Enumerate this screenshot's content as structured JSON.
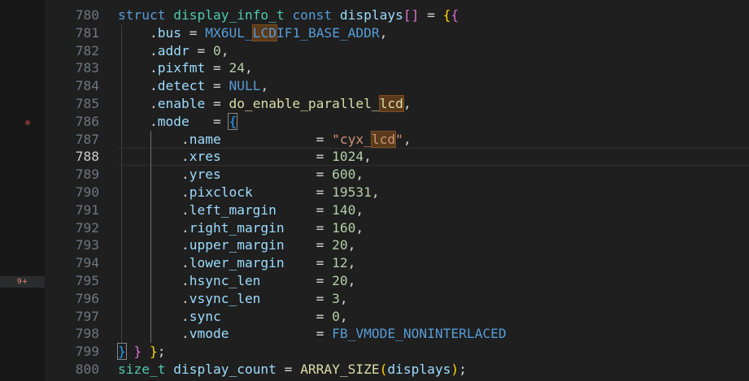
{
  "gutter": {
    "badge_text": "9+"
  },
  "editor": {
    "active_line": 788,
    "lines": [
      {
        "num": "780",
        "tokens": [
          [
            "kw",
            "struct"
          ],
          [
            "op",
            " "
          ],
          [
            "ty",
            "display_info_t"
          ],
          [
            "op",
            " "
          ],
          [
            "kw",
            "const"
          ],
          [
            "op",
            " "
          ],
          [
            "id",
            "displays"
          ],
          [
            "br2",
            "[]"
          ],
          [
            "op",
            " = "
          ],
          [
            "br1",
            "{"
          ],
          [
            "br2",
            "{"
          ]
        ]
      },
      {
        "num": "781",
        "tokens": [
          [
            "op",
            "    ."
          ],
          [
            "id",
            "bus"
          ],
          [
            "op",
            " = "
          ],
          [
            "mac",
            "MX6UL_"
          ],
          [
            "mac hl",
            "LCD"
          ],
          [
            "mac",
            "IF1_BASE_ADDR"
          ],
          [
            "op",
            ","
          ]
        ]
      },
      {
        "num": "782",
        "tokens": [
          [
            "op",
            "    ."
          ],
          [
            "id",
            "addr"
          ],
          [
            "op",
            " = "
          ],
          [
            "num",
            "0"
          ],
          [
            "op",
            ","
          ]
        ]
      },
      {
        "num": "783",
        "tokens": [
          [
            "op",
            "    ."
          ],
          [
            "id",
            "pixfmt"
          ],
          [
            "op",
            " = "
          ],
          [
            "num",
            "24"
          ],
          [
            "op",
            ","
          ]
        ]
      },
      {
        "num": "784",
        "tokens": [
          [
            "op",
            "    ."
          ],
          [
            "id",
            "detect"
          ],
          [
            "op",
            " = "
          ],
          [
            "mac",
            "NULL"
          ],
          [
            "op",
            ","
          ]
        ]
      },
      {
        "num": "785",
        "tokens": [
          [
            "op",
            "    ."
          ],
          [
            "id",
            "enable"
          ],
          [
            "op",
            " = "
          ],
          [
            "fn",
            "do_enable_parallel_"
          ],
          [
            "fn hl",
            "lcd"
          ],
          [
            "op",
            ","
          ]
        ]
      },
      {
        "num": "786",
        "tokens": [
          [
            "op",
            "    ."
          ],
          [
            "id",
            "mode"
          ],
          [
            "op",
            "   = "
          ],
          [
            "br3 bbox",
            "{"
          ]
        ]
      },
      {
        "num": "787",
        "tokens": [
          [
            "op",
            "        ."
          ],
          [
            "id",
            "name"
          ],
          [
            "op",
            "            = "
          ],
          [
            "str",
            "\"cyx_"
          ],
          [
            "str hl",
            "lcd"
          ],
          [
            "str",
            "\""
          ],
          [
            "op",
            ","
          ]
        ]
      },
      {
        "num": "788",
        "tokens": [
          [
            "op",
            "        ."
          ],
          [
            "id",
            "xres"
          ],
          [
            "op",
            "            = "
          ],
          [
            "num",
            "1024"
          ],
          [
            "op",
            ","
          ]
        ]
      },
      {
        "num": "789",
        "tokens": [
          [
            "op",
            "        ."
          ],
          [
            "id",
            "yres"
          ],
          [
            "op",
            "            = "
          ],
          [
            "num",
            "600"
          ],
          [
            "op",
            ","
          ]
        ]
      },
      {
        "num": "790",
        "tokens": [
          [
            "op",
            "        ."
          ],
          [
            "id",
            "pixclock"
          ],
          [
            "op",
            "        = "
          ],
          [
            "num",
            "19531"
          ],
          [
            "op",
            ","
          ]
        ]
      },
      {
        "num": "791",
        "tokens": [
          [
            "op",
            "        ."
          ],
          [
            "id",
            "left_margin"
          ],
          [
            "op",
            "     = "
          ],
          [
            "num",
            "140"
          ],
          [
            "op",
            ","
          ]
        ]
      },
      {
        "num": "792",
        "tokens": [
          [
            "op",
            "        ."
          ],
          [
            "id",
            "right_margin"
          ],
          [
            "op",
            "    = "
          ],
          [
            "num",
            "160"
          ],
          [
            "op",
            ","
          ]
        ]
      },
      {
        "num": "793",
        "tokens": [
          [
            "op",
            "        ."
          ],
          [
            "id",
            "upper_margin"
          ],
          [
            "op",
            "    = "
          ],
          [
            "num",
            "20"
          ],
          [
            "op",
            ","
          ]
        ]
      },
      {
        "num": "794",
        "tokens": [
          [
            "op",
            "        ."
          ],
          [
            "id",
            "lower_margin"
          ],
          [
            "op",
            "    = "
          ],
          [
            "num",
            "12"
          ],
          [
            "op",
            ","
          ]
        ]
      },
      {
        "num": "795",
        "tokens": [
          [
            "op",
            "        ."
          ],
          [
            "id",
            "hsync_len"
          ],
          [
            "op",
            "       = "
          ],
          [
            "num",
            "20"
          ],
          [
            "op",
            ","
          ]
        ]
      },
      {
        "num": "796",
        "tokens": [
          [
            "op",
            "        ."
          ],
          [
            "id",
            "vsync_len"
          ],
          [
            "op",
            "       = "
          ],
          [
            "num",
            "3"
          ],
          [
            "op",
            ","
          ]
        ]
      },
      {
        "num": "797",
        "tokens": [
          [
            "op",
            "        ."
          ],
          [
            "id",
            "sync"
          ],
          [
            "op",
            "            = "
          ],
          [
            "num",
            "0"
          ],
          [
            "op",
            ","
          ]
        ]
      },
      {
        "num": "798",
        "tokens": [
          [
            "op",
            "        ."
          ],
          [
            "id",
            "vmode"
          ],
          [
            "op",
            "           = "
          ],
          [
            "mac",
            "FB_VMODE_NONINTERLACED"
          ]
        ]
      },
      {
        "num": "799",
        "tokens": [
          [
            "br3 bbox",
            "}"
          ],
          [
            "op",
            " "
          ],
          [
            "br2",
            "}"
          ],
          [
            "op",
            " "
          ],
          [
            "br1",
            "}"
          ],
          [
            "op",
            ";"
          ]
        ]
      },
      {
        "num": "800",
        "tokens": [
          [
            "ty",
            "size_t"
          ],
          [
            "op",
            " "
          ],
          [
            "id",
            "display_count"
          ],
          [
            "op",
            " = "
          ],
          [
            "fn",
            "ARRAY_SIZE"
          ],
          [
            "br1",
            "("
          ],
          [
            "id",
            "displays"
          ],
          [
            "br1",
            ")"
          ],
          [
            "op",
            ";"
          ]
        ]
      }
    ]
  }
}
